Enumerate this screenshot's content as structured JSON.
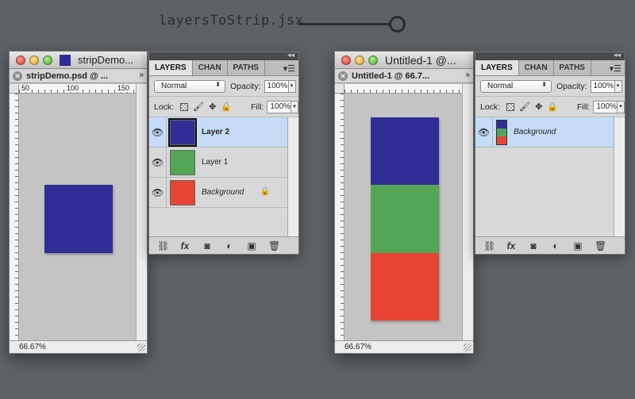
{
  "script": {
    "title": "layersToStrip.jsx"
  },
  "colors": {
    "blue": "#2e2e96",
    "green": "#54a555",
    "red": "#e84436",
    "canvas_gray": "#c4c4c4",
    "selection": "#c5dbf6"
  },
  "left_doc": {
    "window_title": "stripDemo...",
    "tab_label": "stripDemo.psd @ ...",
    "ruler_h": [
      "50",
      "100",
      "150"
    ],
    "zoom": "66.67%"
  },
  "left_panel": {
    "tabs": [
      "LAYERS",
      "CHAN",
      "PATHS"
    ],
    "blend_mode": "Normal",
    "opacity_label": "Opacity:",
    "opacity_value": "100%",
    "lock_label": "Lock:",
    "fill_label": "Fill:",
    "fill_value": "100%",
    "layers": [
      {
        "name": "Layer 2",
        "color": "#2e2e96",
        "selected": true
      },
      {
        "name": "Layer 1",
        "color": "#54a555",
        "selected": false
      },
      {
        "name": "Background",
        "color": "#e84436",
        "selected": false,
        "locked": true
      }
    ]
  },
  "right_doc": {
    "window_title": "Untitled-1 @...",
    "tab_label": "Untitled-1 @ 66.7...",
    "zoom": "66.67%"
  },
  "right_panel": {
    "tabs": [
      "LAYERS",
      "CHAN",
      "PATHS"
    ],
    "blend_mode": "Normal",
    "opacity_label": "Opacity:",
    "opacity_value": "100%",
    "lock_label": "Lock:",
    "fill_label": "Fill:",
    "fill_value": "100%",
    "layers": [
      {
        "name": "Background",
        "selected": true
      }
    ]
  },
  "icons": {
    "eye": "eye-icon",
    "link": "link-icon",
    "fx": "fx-icon",
    "mask": "mask-icon",
    "adjust": "adjustment-icon",
    "new": "new-layer-icon",
    "trash": "trash-icon",
    "lock": "lock-icon",
    "brush": "brush-icon",
    "move": "move-icon",
    "menu": "panel-menu-icon"
  }
}
